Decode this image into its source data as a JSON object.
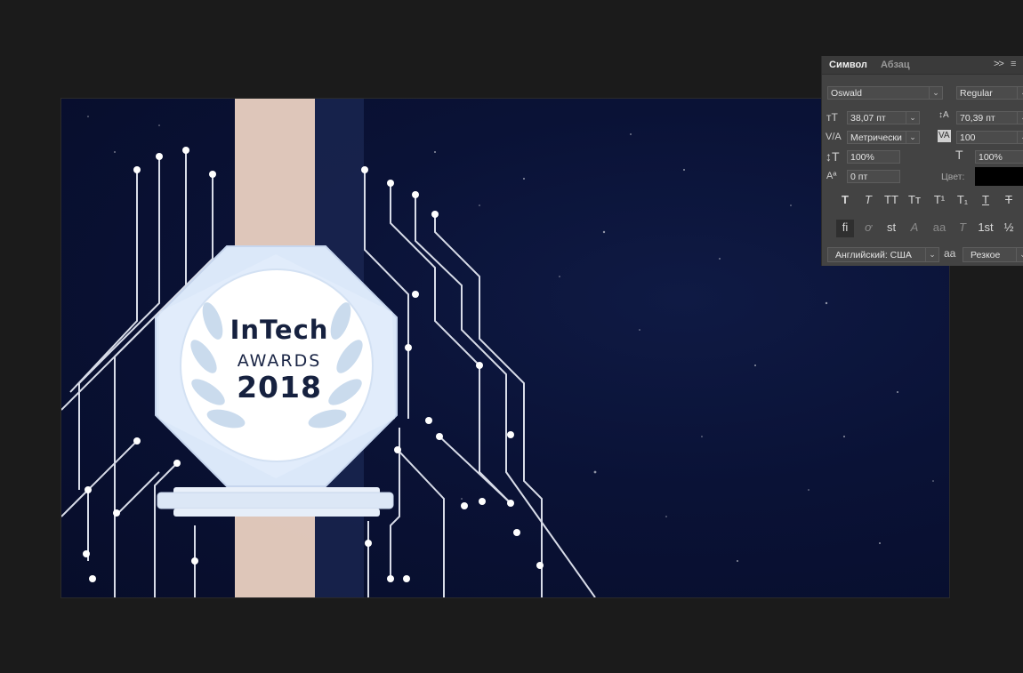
{
  "canvas": {
    "badge": {
      "line1": "InTech",
      "line2": "AWARDS",
      "line3": "2018"
    },
    "colors": {
      "background": "#0a1236",
      "stroke": "#f5e2d6",
      "circuit": "#d9dde8"
    }
  },
  "character_panel": {
    "tabs": [
      "Символ",
      "Абзац"
    ],
    "collapse_icon": ">>",
    "menu_icon": "≡",
    "font_family": "Oswald",
    "font_style": "Regular",
    "font_size": "38,07 пт",
    "leading": "70,39 пт",
    "kerning": "Метрически",
    "tracking": "100",
    "vertical_scale": "100%",
    "horizontal_scale": "100%",
    "baseline_shift": "0 пт",
    "color_label": "Цвет:",
    "color_value": "#000000",
    "language": "Английский: США",
    "antialias_icon": "aa",
    "antialias": "Резкое",
    "style_buttons": [
      "T",
      "T",
      "TT",
      "Tт",
      "T¹",
      "T₁",
      "T",
      "T"
    ],
    "opentype_buttons": [
      "fi",
      "ơ",
      "st",
      "A",
      "aa",
      "T",
      "1st",
      "½"
    ]
  }
}
